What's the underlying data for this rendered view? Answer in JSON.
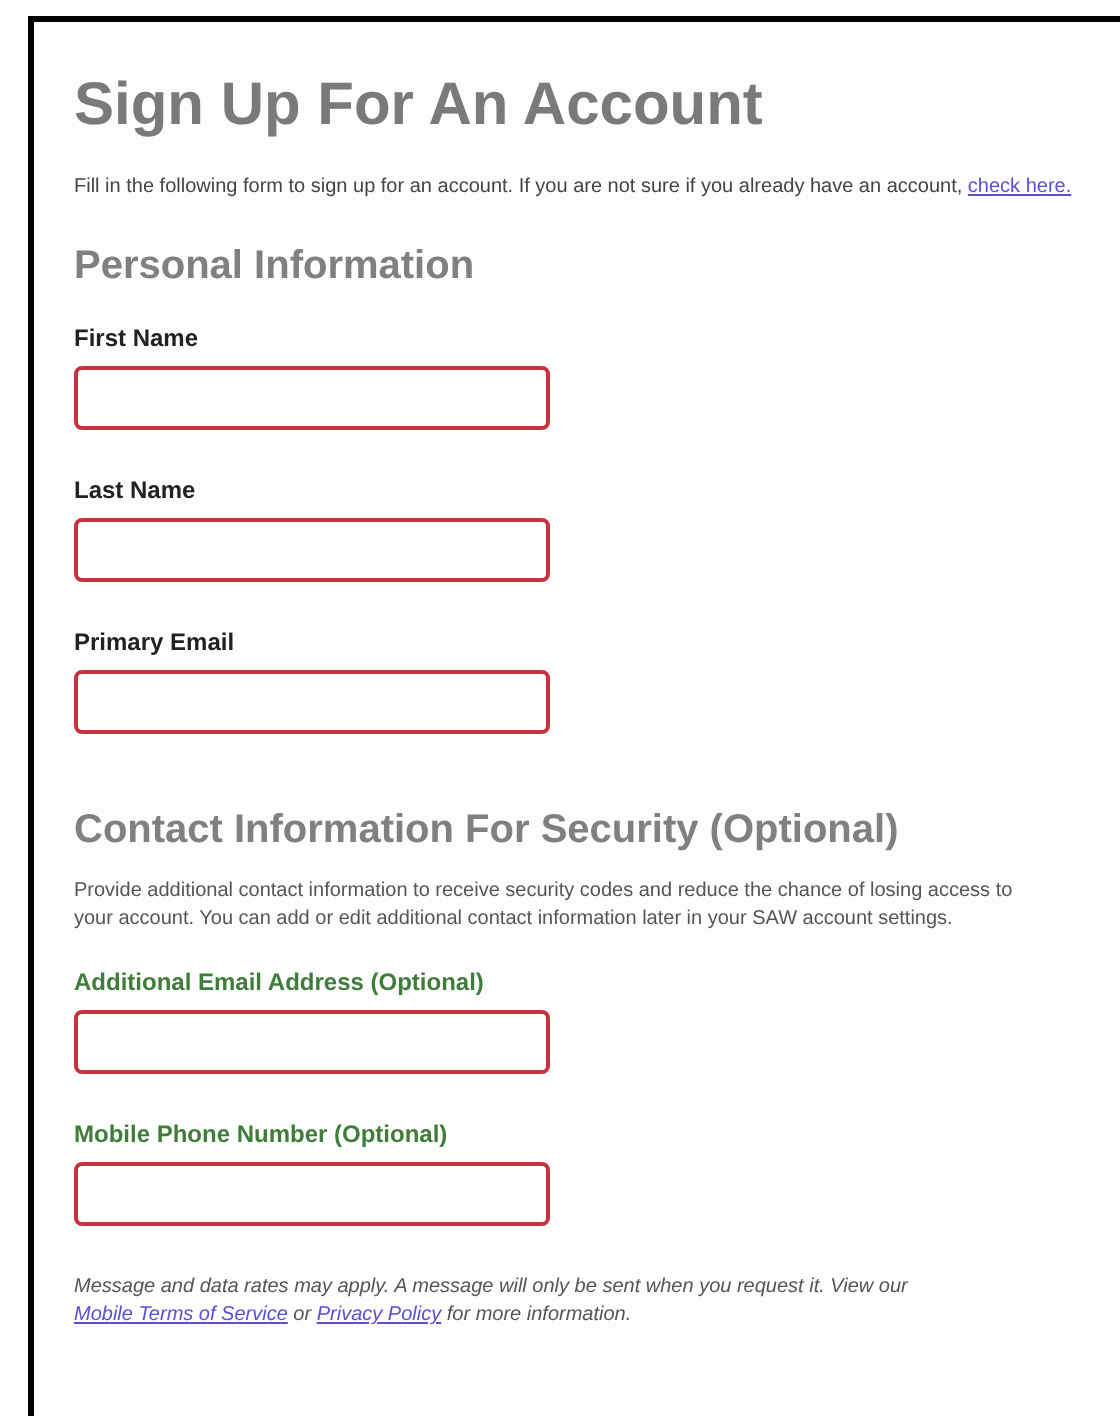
{
  "title": "Sign Up For An Account",
  "intro": [
    {
      "kind": "text",
      "text": "Fill in the following form to sign up for an account. If you are not sure if you already have an account,"
    },
    {
      "kind": "link",
      "text": "check here."
    }
  ],
  "sections": [
    {
      "heading": "Personal Information",
      "fields": [
        {
          "label": "First Name",
          "color": "#222222"
        },
        {
          "label": "Last Name",
          "color": "#222222"
        },
        {
          "label": "Primary Email",
          "color": "#222222"
        }
      ]
    },
    {
      "heading": "Contact Information For Security (Optional)",
      "description": [
        {
          "kind": "text",
          "text": "Provide additional contact information to receive security codes and reduce the chance of losing access to your account. You can add or edit additional contact information later in your SAW account settings."
        }
      ],
      "fields": [
        {
          "label": "Additional Email Address (Optional)",
          "color": "#3f7d3a"
        },
        {
          "label": "Mobile Phone Number (Optional)",
          "color": "#3f7d3a"
        }
      ]
    }
  ],
  "note": [
    {
      "kind": "text",
      "text": "Message and data rates may apply. A message will only be sent when you request it. View our"
    },
    {
      "kind": "link",
      "text": "Mobile Terms of Service"
    },
    {
      "kind": "text",
      "text": "or"
    },
    {
      "kind": "link",
      "text": "Privacy Policy"
    },
    {
      "kind": "text",
      "text": "for more information."
    }
  ]
}
